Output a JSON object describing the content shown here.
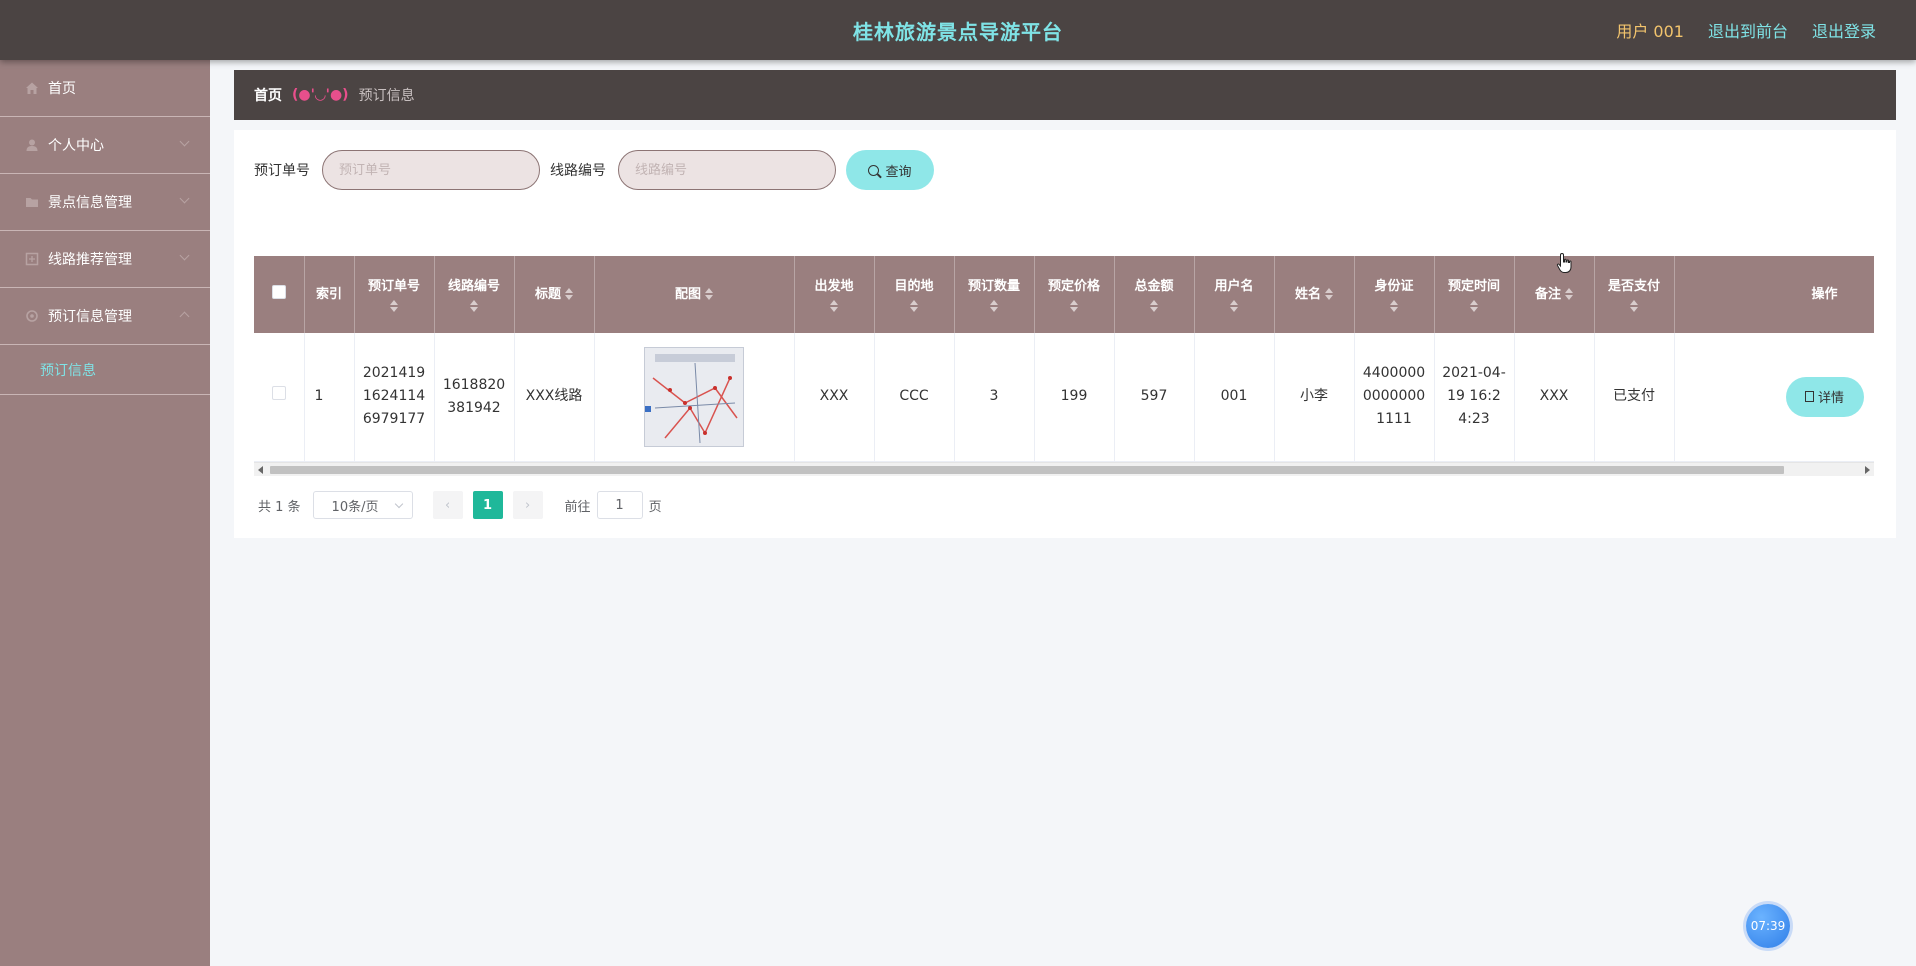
{
  "header": {
    "app_title": "桂林旅游景点导游平台",
    "user_label": "用户 001",
    "exit_front_label": "退出到前台",
    "logout_label": "退出登录"
  },
  "sidebar": {
    "items": [
      {
        "label": "首页",
        "icon": "home-icon"
      },
      {
        "label": "个人中心",
        "icon": "user-icon"
      },
      {
        "label": "景点信息管理",
        "icon": "folder-icon"
      },
      {
        "label": "线路推荐管理",
        "icon": "folder-icon"
      },
      {
        "label": "预订信息管理",
        "icon": "settings-icon"
      }
    ],
    "sub_item": "预订信息"
  },
  "breadcrumb": {
    "home": "首页",
    "separator": "(●'◡'●)",
    "current": "预订信息"
  },
  "search": {
    "order_label": "预订单号",
    "order_placeholder": "预订单号",
    "route_label": "线路编号",
    "route_placeholder": "线路编号",
    "query_label": "查询"
  },
  "table": {
    "headers": [
      "索引",
      "预订单号",
      "线路编号",
      "标题",
      "配图",
      "出发地",
      "目的地",
      "预订数量",
      "预定价格",
      "总金额",
      "用户名",
      "姓名",
      "身份证",
      "预定时间",
      "备注",
      "是否支付",
      "操作"
    ],
    "rows": [
      {
        "index": "1",
        "order_no": "20214191624114697917 7",
        "order_no_display": "202141916241146979177",
        "route_no": "1618820381942",
        "title": "XXX线路",
        "origin": "XXX",
        "destination": "CCC",
        "quantity": "3",
        "price": "199",
        "total": "597",
        "username": "001",
        "name": "小李",
        "id_card": "440000000000001111",
        "time": "2021-04-19 16:24:23",
        "remark": "XXX",
        "paid": "已支付",
        "action": "详情"
      }
    ]
  },
  "pagination": {
    "total": "共 1 条",
    "page_size": "10条/页",
    "current_page": "1",
    "goto_label": "前往",
    "goto_value": "1",
    "page_suffix": "页"
  },
  "clock": "07:39"
}
